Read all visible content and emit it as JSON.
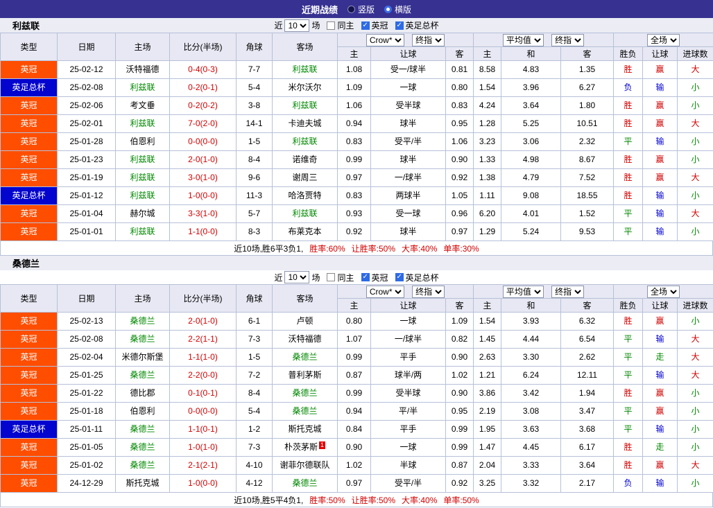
{
  "topbar": {
    "title": "近期战绩",
    "radios": [
      {
        "label": "竖版",
        "checked": false
      },
      {
        "label": "横版",
        "checked": true
      }
    ]
  },
  "filter": {
    "near": "近",
    "count": "10",
    "unit": "场",
    "checkboxes": [
      {
        "label": "同主",
        "checked": false
      },
      {
        "label": "英冠",
        "checked": true
      },
      {
        "label": "英足总杯",
        "checked": true
      }
    ]
  },
  "header": {
    "cols": [
      "类型",
      "日期",
      "主场",
      "比分(半场)",
      "角球",
      "客场"
    ],
    "group1_selects": [
      "Crow*",
      "终指"
    ],
    "group1_cols": [
      "主",
      "让球",
      "客"
    ],
    "group2_selects": [
      "平均值",
      "终指"
    ],
    "group2_cols": [
      "主",
      "和",
      "客"
    ],
    "group3_select": "全场",
    "group3_cols": [
      "胜负",
      "让球",
      "进球数"
    ]
  },
  "colors": {
    "focus_team": "#008800",
    "score": "#d10000",
    "league_bg": "#ff4e00",
    "cup_bg": "#0404cf"
  },
  "result_colors": {
    "胜": "#d10000",
    "平": "#008800",
    "负": "#0000cc",
    "赢": "#d10000",
    "输": "#0000cc",
    "走": "#008800",
    "大": "#d10000",
    "小": "#008800"
  },
  "sections": [
    {
      "team": "利兹联",
      "rows": [
        {
          "type": "英冠",
          "type_class": "type-league",
          "date": "25-02-12",
          "home": "沃特福德",
          "home_focus": false,
          "score": "0-4(0-3)",
          "corner": "7-7",
          "away": "利兹联",
          "away_focus": true,
          "odds": [
            "1.08",
            "受一/球半",
            "0.81"
          ],
          "avg": [
            "8.58",
            "4.83",
            "1.35"
          ],
          "results": [
            "胜",
            "赢",
            "大"
          ]
        },
        {
          "type": "英足总杯",
          "type_class": "type-cup",
          "date": "25-02-08",
          "home": "利兹联",
          "home_focus": true,
          "score": "0-2(0-1)",
          "corner": "5-4",
          "away": "米尔沃尔",
          "away_focus": false,
          "odds": [
            "1.09",
            "一球",
            "0.80"
          ],
          "avg": [
            "1.54",
            "3.96",
            "6.27"
          ],
          "results": [
            "负",
            "输",
            "小"
          ]
        },
        {
          "type": "英冠",
          "type_class": "type-league",
          "date": "25-02-06",
          "home": "考文垂",
          "home_focus": false,
          "score": "0-2(0-2)",
          "corner": "3-8",
          "away": "利兹联",
          "away_focus": true,
          "odds": [
            "1.06",
            "受半球",
            "0.83"
          ],
          "avg": [
            "4.24",
            "3.64",
            "1.80"
          ],
          "results": [
            "胜",
            "赢",
            "小"
          ]
        },
        {
          "type": "英冠",
          "type_class": "type-league",
          "date": "25-02-01",
          "home": "利兹联",
          "home_focus": true,
          "score": "7-0(2-0)",
          "corner": "14-1",
          "away": "卡迪夫城",
          "away_focus": false,
          "odds": [
            "0.94",
            "球半",
            "0.95"
          ],
          "avg": [
            "1.28",
            "5.25",
            "10.51"
          ],
          "results": [
            "胜",
            "赢",
            "大"
          ]
        },
        {
          "type": "英冠",
          "type_class": "type-league",
          "date": "25-01-28",
          "home": "伯恩利",
          "home_focus": false,
          "score": "0-0(0-0)",
          "corner": "1-5",
          "away": "利兹联",
          "away_focus": true,
          "odds": [
            "0.83",
            "受平/半",
            "1.06"
          ],
          "avg": [
            "3.23",
            "3.06",
            "2.32"
          ],
          "results": [
            "平",
            "输",
            "小"
          ]
        },
        {
          "type": "英冠",
          "type_class": "type-league",
          "date": "25-01-23",
          "home": "利兹联",
          "home_focus": true,
          "score": "2-0(1-0)",
          "corner": "8-4",
          "away": "诺维奇",
          "away_focus": false,
          "odds": [
            "0.99",
            "球半",
            "0.90"
          ],
          "avg": [
            "1.33",
            "4.98",
            "8.67"
          ],
          "results": [
            "胜",
            "赢",
            "小"
          ]
        },
        {
          "type": "英冠",
          "type_class": "type-league",
          "date": "25-01-19",
          "home": "利兹联",
          "home_focus": true,
          "score": "3-0(1-0)",
          "corner": "9-6",
          "away": "谢周三",
          "away_focus": false,
          "odds": [
            "0.97",
            "一/球半",
            "0.92"
          ],
          "avg": [
            "1.38",
            "4.79",
            "7.52"
          ],
          "results": [
            "胜",
            "赢",
            "大"
          ]
        },
        {
          "type": "英足总杯",
          "type_class": "type-cup",
          "date": "25-01-12",
          "home": "利兹联",
          "home_focus": true,
          "score": "1-0(0-0)",
          "corner": "11-3",
          "away": "哈洛贾特",
          "away_focus": false,
          "odds": [
            "0.83",
            "两球半",
            "1.05"
          ],
          "avg": [
            "1.11",
            "9.08",
            "18.55"
          ],
          "results": [
            "胜",
            "输",
            "小"
          ]
        },
        {
          "type": "英冠",
          "type_class": "type-league",
          "date": "25-01-04",
          "home": "赫尔城",
          "home_focus": false,
          "score": "3-3(1-0)",
          "corner": "5-7",
          "away": "利兹联",
          "away_focus": true,
          "odds": [
            "0.93",
            "受一球",
            "0.96"
          ],
          "avg": [
            "6.20",
            "4.01",
            "1.52"
          ],
          "results": [
            "平",
            "输",
            "大"
          ]
        },
        {
          "type": "英冠",
          "type_class": "type-league",
          "date": "25-01-01",
          "home": "利兹联",
          "home_focus": true,
          "score": "1-1(0-0)",
          "corner": "8-3",
          "away": "布莱克本",
          "away_focus": false,
          "odds": [
            "0.92",
            "球半",
            "0.97"
          ],
          "avg": [
            "1.29",
            "5.24",
            "9.53"
          ],
          "results": [
            "平",
            "输",
            "小"
          ]
        }
      ],
      "summary": {
        "prefix": "近10场,胜6平3负1,",
        "stats": [
          "胜率:60%",
          "让胜率:50%",
          "大率:40%",
          "单率:30%"
        ]
      }
    },
    {
      "team": "桑德兰",
      "rows": [
        {
          "type": "英冠",
          "type_class": "type-league",
          "date": "25-02-13",
          "home": "桑德兰",
          "home_focus": true,
          "score": "2-0(1-0)",
          "corner": "6-1",
          "away": "卢顿",
          "away_focus": false,
          "odds": [
            "0.80",
            "一球",
            "1.09"
          ],
          "avg": [
            "1.54",
            "3.93",
            "6.32"
          ],
          "results": [
            "胜",
            "赢",
            "小"
          ]
        },
        {
          "type": "英冠",
          "type_class": "type-league",
          "date": "25-02-08",
          "home": "桑德兰",
          "home_focus": true,
          "score": "2-2(1-1)",
          "corner": "7-3",
          "away": "沃特福德",
          "away_focus": false,
          "odds": [
            "1.07",
            "一/球半",
            "0.82"
          ],
          "avg": [
            "1.45",
            "4.44",
            "6.54"
          ],
          "results": [
            "平",
            "输",
            "大"
          ]
        },
        {
          "type": "英冠",
          "type_class": "type-league",
          "date": "25-02-04",
          "home": "米德尔斯堡",
          "home_focus": false,
          "score": "1-1(1-0)",
          "corner": "1-5",
          "away": "桑德兰",
          "away_focus": true,
          "odds": [
            "0.99",
            "平手",
            "0.90"
          ],
          "avg": [
            "2.63",
            "3.30",
            "2.62"
          ],
          "results": [
            "平",
            "走",
            "大"
          ]
        },
        {
          "type": "英冠",
          "type_class": "type-league",
          "date": "25-01-25",
          "home": "桑德兰",
          "home_focus": true,
          "score": "2-2(0-0)",
          "corner": "7-2",
          "away": "普利茅斯",
          "away_focus": false,
          "odds": [
            "0.87",
            "球半/两",
            "1.02"
          ],
          "avg": [
            "1.21",
            "6.24",
            "12.11"
          ],
          "results": [
            "平",
            "输",
            "大"
          ]
        },
        {
          "type": "英冠",
          "type_class": "type-league",
          "date": "25-01-22",
          "home": "德比郡",
          "home_focus": false,
          "score": "0-1(0-1)",
          "corner": "8-4",
          "away": "桑德兰",
          "away_focus": true,
          "odds": [
            "0.99",
            "受半球",
            "0.90"
          ],
          "avg": [
            "3.86",
            "3.42",
            "1.94"
          ],
          "results": [
            "胜",
            "赢",
            "小"
          ]
        },
        {
          "type": "英冠",
          "type_class": "type-league",
          "date": "25-01-18",
          "home": "伯恩利",
          "home_focus": false,
          "score": "0-0(0-0)",
          "corner": "5-4",
          "away": "桑德兰",
          "away_focus": true,
          "odds": [
            "0.94",
            "平/半",
            "0.95"
          ],
          "avg": [
            "2.19",
            "3.08",
            "3.47"
          ],
          "results": [
            "平",
            "赢",
            "小"
          ]
        },
        {
          "type": "英足总杯",
          "type_class": "type-cup",
          "date": "25-01-11",
          "home": "桑德兰",
          "home_focus": true,
          "score": "1-1(0-1)",
          "corner": "1-2",
          "away": "斯托克城",
          "away_focus": false,
          "odds": [
            "0.84",
            "平手",
            "0.99"
          ],
          "avg": [
            "1.95",
            "3.63",
            "3.68"
          ],
          "results": [
            "平",
            "输",
            "小"
          ]
        },
        {
          "type": "英冠",
          "type_class": "type-league",
          "date": "25-01-05",
          "home": "桑德兰",
          "home_focus": true,
          "score": "1-0(1-0)",
          "corner": "7-3",
          "away": "朴茨茅斯",
          "away_focus": false,
          "away_badge": "1",
          "odds": [
            "0.90",
            "一球",
            "0.99"
          ],
          "avg": [
            "1.47",
            "4.45",
            "6.17"
          ],
          "results": [
            "胜",
            "走",
            "小"
          ]
        },
        {
          "type": "英冠",
          "type_class": "type-league",
          "date": "25-01-02",
          "home": "桑德兰",
          "home_focus": true,
          "score": "2-1(2-1)",
          "corner": "4-10",
          "away": "谢菲尔德联队",
          "away_focus": false,
          "odds": [
            "1.02",
            "半球",
            "0.87"
          ],
          "avg": [
            "2.04",
            "3.33",
            "3.64"
          ],
          "results": [
            "胜",
            "赢",
            "大"
          ]
        },
        {
          "type": "英冠",
          "type_class": "type-league",
          "date": "24-12-29",
          "home": "斯托克城",
          "home_focus": false,
          "score": "1-0(0-0)",
          "corner": "4-12",
          "away": "桑德兰",
          "away_focus": true,
          "odds": [
            "0.97",
            "受平/半",
            "0.92"
          ],
          "avg": [
            "3.25",
            "3.32",
            "2.17"
          ],
          "results": [
            "负",
            "输",
            "小"
          ]
        }
      ],
      "summary": {
        "prefix": "近10场,胜5平4负1,",
        "stats": [
          "胜率:50%",
          "让胜率:50%",
          "大率:40%",
          "单率:50%"
        ]
      }
    }
  ]
}
